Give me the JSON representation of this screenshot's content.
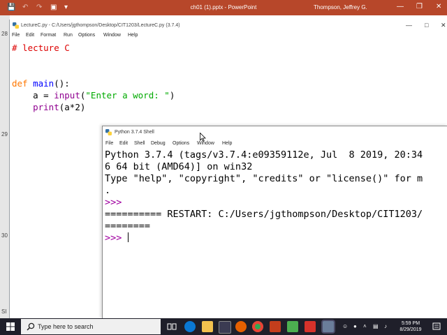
{
  "powerpoint": {
    "title": "ch01 (1).pptx  -  PowerPoint",
    "user": "Thompson, Jeffrey G.",
    "slide_numbers": [
      "28",
      "29",
      "30",
      "SI"
    ]
  },
  "editor": {
    "title": "LectureC.py - C:/Users/jgthompson/Desktop/CIT1203/LectureC.py (3.7.4)",
    "menu": [
      "File",
      "Edit",
      "Format",
      "Run",
      "Options",
      "Window",
      "Help"
    ],
    "code": {
      "line1": "# lecture C",
      "def_kw": "def",
      "func_name": "main",
      "def_rest": "():",
      "assign_prefix": "    a = ",
      "input_fn": "input",
      "paren_open": "(",
      "prompt_str": "\"Enter a word: \"",
      "paren_close": ")",
      "indent": "    ",
      "print_fn": "print",
      "print_args": "(a*2)"
    }
  },
  "shell": {
    "title": "Python 3.7.4 Shell",
    "menu": [
      "File",
      "Edit",
      "Shell",
      "Debug",
      "Options",
      "Window",
      "Help"
    ],
    "lines": [
      "Python 3.7.4 (tags/v3.7.4:e09359112e, Jul  8 2019, 20:34",
      "6 64 bit (AMD64)] on win32",
      "Type \"help\", \"copyright\", \"credits\" or \"license()\" for m",
      "."
    ],
    "prompt": ">>>",
    "restart_line": "========== RESTART: C:/Users/jgthompson/Desktop/CIT1203/",
    "restart_tail": "========"
  },
  "taskbar": {
    "search_placeholder": "Type here to search",
    "time": "5:59 PM",
    "date": "8/29/2019"
  },
  "colors": {
    "ppt_bar": "#b7472a",
    "taskbar": "#1f1f2a",
    "keyword": "#ff7700",
    "string": "#00aa00",
    "builtin": "#900090",
    "comment": "#dd0000",
    "prompt": "#a000a0"
  }
}
